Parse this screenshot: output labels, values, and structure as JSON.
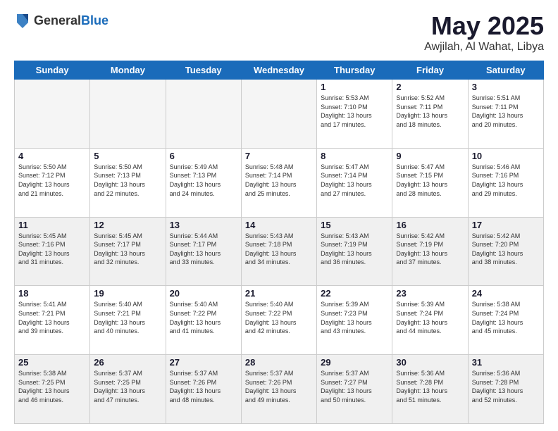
{
  "header": {
    "logo_general": "General",
    "logo_blue": "Blue",
    "month": "May 2025",
    "location": "Awjilah, Al Wahat, Libya"
  },
  "weekdays": [
    "Sunday",
    "Monday",
    "Tuesday",
    "Wednesday",
    "Thursday",
    "Friday",
    "Saturday"
  ],
  "weeks": [
    [
      {
        "day": "",
        "info": "",
        "empty": true
      },
      {
        "day": "",
        "info": "",
        "empty": true
      },
      {
        "day": "",
        "info": "",
        "empty": true
      },
      {
        "day": "",
        "info": "",
        "empty": true
      },
      {
        "day": "1",
        "info": "Sunrise: 5:53 AM\nSunset: 7:10 PM\nDaylight: 13 hours\nand 17 minutes.",
        "empty": false
      },
      {
        "day": "2",
        "info": "Sunrise: 5:52 AM\nSunset: 7:11 PM\nDaylight: 13 hours\nand 18 minutes.",
        "empty": false
      },
      {
        "day": "3",
        "info": "Sunrise: 5:51 AM\nSunset: 7:11 PM\nDaylight: 13 hours\nand 20 minutes.",
        "empty": false
      }
    ],
    [
      {
        "day": "4",
        "info": "Sunrise: 5:50 AM\nSunset: 7:12 PM\nDaylight: 13 hours\nand 21 minutes.",
        "empty": false
      },
      {
        "day": "5",
        "info": "Sunrise: 5:50 AM\nSunset: 7:13 PM\nDaylight: 13 hours\nand 22 minutes.",
        "empty": false
      },
      {
        "day": "6",
        "info": "Sunrise: 5:49 AM\nSunset: 7:13 PM\nDaylight: 13 hours\nand 24 minutes.",
        "empty": false
      },
      {
        "day": "7",
        "info": "Sunrise: 5:48 AM\nSunset: 7:14 PM\nDaylight: 13 hours\nand 25 minutes.",
        "empty": false
      },
      {
        "day": "8",
        "info": "Sunrise: 5:47 AM\nSunset: 7:14 PM\nDaylight: 13 hours\nand 27 minutes.",
        "empty": false
      },
      {
        "day": "9",
        "info": "Sunrise: 5:47 AM\nSunset: 7:15 PM\nDaylight: 13 hours\nand 28 minutes.",
        "empty": false
      },
      {
        "day": "10",
        "info": "Sunrise: 5:46 AM\nSunset: 7:16 PM\nDaylight: 13 hours\nand 29 minutes.",
        "empty": false
      }
    ],
    [
      {
        "day": "11",
        "info": "Sunrise: 5:45 AM\nSunset: 7:16 PM\nDaylight: 13 hours\nand 31 minutes.",
        "empty": false
      },
      {
        "day": "12",
        "info": "Sunrise: 5:45 AM\nSunset: 7:17 PM\nDaylight: 13 hours\nand 32 minutes.",
        "empty": false
      },
      {
        "day": "13",
        "info": "Sunrise: 5:44 AM\nSunset: 7:17 PM\nDaylight: 13 hours\nand 33 minutes.",
        "empty": false
      },
      {
        "day": "14",
        "info": "Sunrise: 5:43 AM\nSunset: 7:18 PM\nDaylight: 13 hours\nand 34 minutes.",
        "empty": false
      },
      {
        "day": "15",
        "info": "Sunrise: 5:43 AM\nSunset: 7:19 PM\nDaylight: 13 hours\nand 36 minutes.",
        "empty": false
      },
      {
        "day": "16",
        "info": "Sunrise: 5:42 AM\nSunset: 7:19 PM\nDaylight: 13 hours\nand 37 minutes.",
        "empty": false
      },
      {
        "day": "17",
        "info": "Sunrise: 5:42 AM\nSunset: 7:20 PM\nDaylight: 13 hours\nand 38 minutes.",
        "empty": false
      }
    ],
    [
      {
        "day": "18",
        "info": "Sunrise: 5:41 AM\nSunset: 7:21 PM\nDaylight: 13 hours\nand 39 minutes.",
        "empty": false
      },
      {
        "day": "19",
        "info": "Sunrise: 5:40 AM\nSunset: 7:21 PM\nDaylight: 13 hours\nand 40 minutes.",
        "empty": false
      },
      {
        "day": "20",
        "info": "Sunrise: 5:40 AM\nSunset: 7:22 PM\nDaylight: 13 hours\nand 41 minutes.",
        "empty": false
      },
      {
        "day": "21",
        "info": "Sunrise: 5:40 AM\nSunset: 7:22 PM\nDaylight: 13 hours\nand 42 minutes.",
        "empty": false
      },
      {
        "day": "22",
        "info": "Sunrise: 5:39 AM\nSunset: 7:23 PM\nDaylight: 13 hours\nand 43 minutes.",
        "empty": false
      },
      {
        "day": "23",
        "info": "Sunrise: 5:39 AM\nSunset: 7:24 PM\nDaylight: 13 hours\nand 44 minutes.",
        "empty": false
      },
      {
        "day": "24",
        "info": "Sunrise: 5:38 AM\nSunset: 7:24 PM\nDaylight: 13 hours\nand 45 minutes.",
        "empty": false
      }
    ],
    [
      {
        "day": "25",
        "info": "Sunrise: 5:38 AM\nSunset: 7:25 PM\nDaylight: 13 hours\nand 46 minutes.",
        "empty": false
      },
      {
        "day": "26",
        "info": "Sunrise: 5:37 AM\nSunset: 7:25 PM\nDaylight: 13 hours\nand 47 minutes.",
        "empty": false
      },
      {
        "day": "27",
        "info": "Sunrise: 5:37 AM\nSunset: 7:26 PM\nDaylight: 13 hours\nand 48 minutes.",
        "empty": false
      },
      {
        "day": "28",
        "info": "Sunrise: 5:37 AM\nSunset: 7:26 PM\nDaylight: 13 hours\nand 49 minutes.",
        "empty": false
      },
      {
        "day": "29",
        "info": "Sunrise: 5:37 AM\nSunset: 7:27 PM\nDaylight: 13 hours\nand 50 minutes.",
        "empty": false
      },
      {
        "day": "30",
        "info": "Sunrise: 5:36 AM\nSunset: 7:28 PM\nDaylight: 13 hours\nand 51 minutes.",
        "empty": false
      },
      {
        "day": "31",
        "info": "Sunrise: 5:36 AM\nSunset: 7:28 PM\nDaylight: 13 hours\nand 52 minutes.",
        "empty": false
      }
    ]
  ]
}
